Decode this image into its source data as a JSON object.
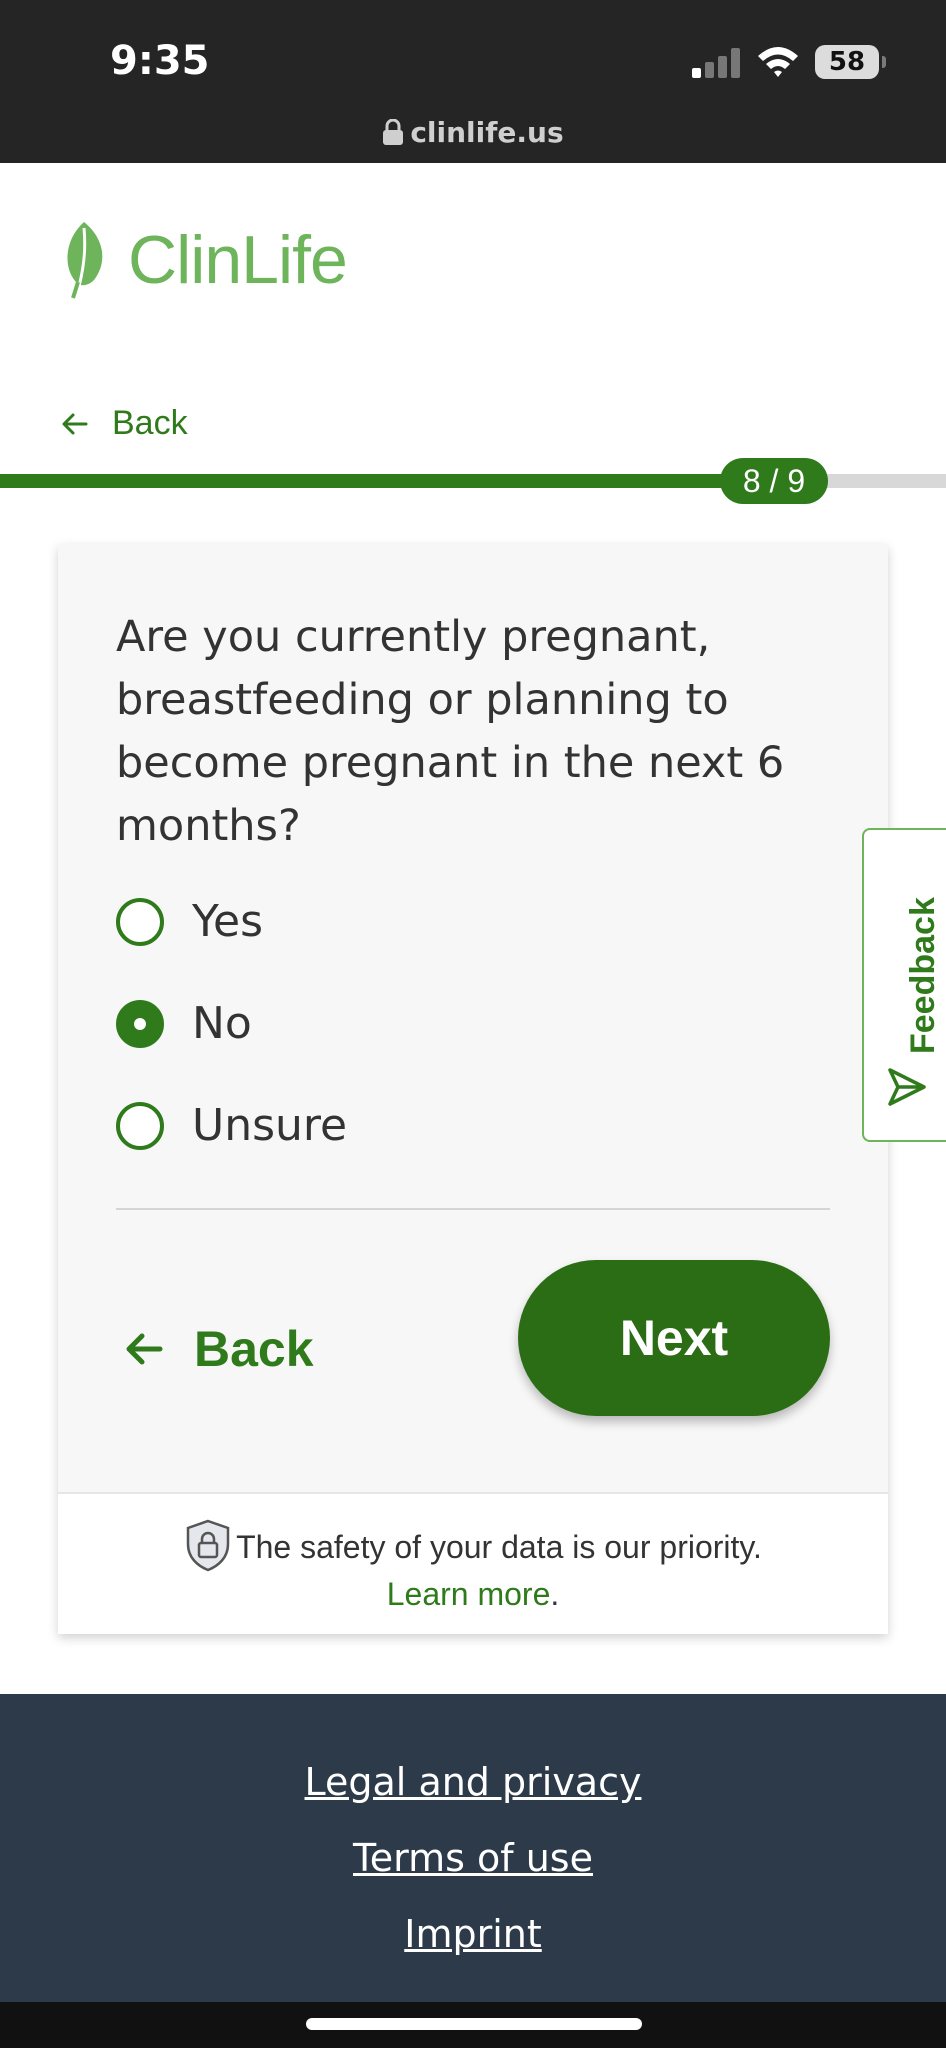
{
  "status_bar": {
    "time": "9:35",
    "battery": "58",
    "url": "clinlife.us"
  },
  "header": {
    "logo_text": "ClinLife",
    "brand_color": "#6db45b",
    "accent_color": "#2f7a1b",
    "back_label": "Back"
  },
  "progress": {
    "label": "8 / 9",
    "current": 8,
    "total": 9
  },
  "question": {
    "text": "Are you currently pregnant, breastfeeding or planning to become pregnant in the next 6 months?",
    "options": [
      {
        "label": "Yes",
        "selected": false
      },
      {
        "label": "No",
        "selected": true
      },
      {
        "label": "Unsure",
        "selected": false
      }
    ],
    "back_label": "Back",
    "next_label": "Next"
  },
  "safety": {
    "text": "The safety of your data is our priority.",
    "link": "Learn more",
    "suffix": "."
  },
  "feedback_label": "Feedback",
  "footer": {
    "links": [
      "Legal and privacy",
      "Terms of use",
      "Imprint"
    ]
  },
  "icons": [
    "lock-icon",
    "leaf-logo-icon",
    "arrow-left-icon",
    "shield-lock-icon",
    "send-icon",
    "signal-icon",
    "wifi-icon",
    "battery-icon"
  ]
}
